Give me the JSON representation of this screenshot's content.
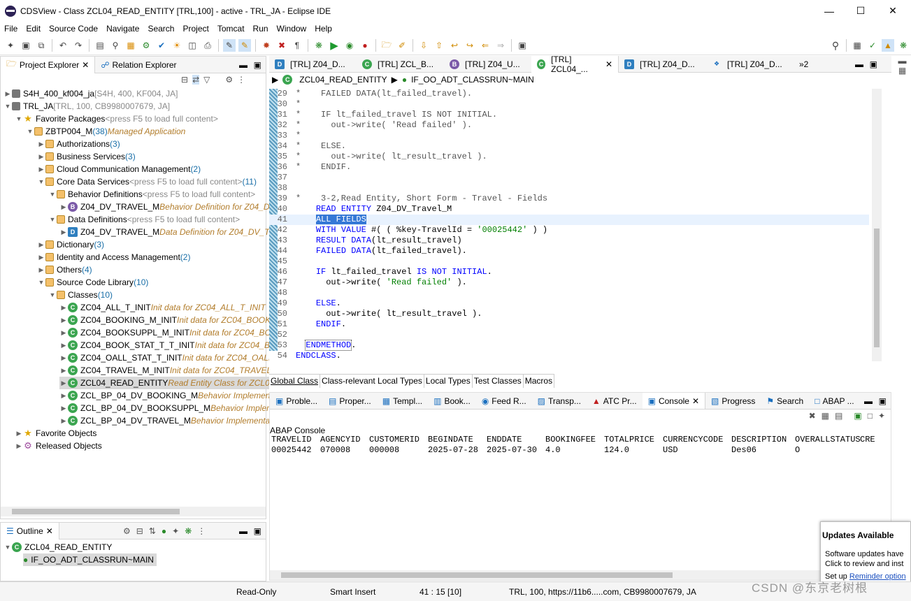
{
  "window": {
    "title": "CDSView - Class ZCL04_READ_ENTITY [TRL,100] - active - TRL_JA - Eclipse IDE"
  },
  "menu": [
    "File",
    "Edit",
    "Source Code",
    "Navigate",
    "Search",
    "Project",
    "Tomcat",
    "Run",
    "Window",
    "Help"
  ],
  "left_tabs": {
    "project_explorer": "Project Explorer",
    "relation_explorer": "Relation Explorer"
  },
  "tree": [
    {
      "level": 0,
      "twisty": "▶",
      "icon": "sys",
      "label": "S4H_400_kf004_ja",
      "extra": "[S4H, 400, KF004, JA]"
    },
    {
      "level": 0,
      "twisty": "▼",
      "icon": "sys",
      "label": "TRL_JA",
      "extra": "[TRL, 100, CB9980007679, JA]"
    },
    {
      "level": 1,
      "twisty": "▼",
      "icon": "star",
      "label": "Favorite Packages",
      "extra": "<press F5 to load full content>"
    },
    {
      "level": 2,
      "twisty": "▼",
      "icon": "pkg",
      "label": "ZBTP004_M",
      "count": "(38)",
      "desc": "Managed Application"
    },
    {
      "level": 3,
      "twisty": "▶",
      "icon": "pkg",
      "label": "Authorizations",
      "count": "(3)"
    },
    {
      "level": 3,
      "twisty": "▶",
      "icon": "pkg",
      "label": "Business Services",
      "count": "(3)"
    },
    {
      "level": 3,
      "twisty": "▶",
      "icon": "pkg",
      "label": "Cloud Communication Management",
      "count": "(2)"
    },
    {
      "level": 3,
      "twisty": "▼",
      "icon": "pkg",
      "label": "Core Data Services",
      "extra": "<press F5 to load full content>",
      "count": "(11)"
    },
    {
      "level": 4,
      "twisty": "▼",
      "icon": "pkg",
      "label": "Behavior Definitions",
      "extra": "<press F5 to load full content>"
    },
    {
      "level": 5,
      "twisty": "▶",
      "icon": "bdef",
      "label": "Z04_DV_TRAVEL_M",
      "desc": "Behavior Definition for Z04_D"
    },
    {
      "level": 4,
      "twisty": "▼",
      "icon": "pkg",
      "label": "Data Definitions",
      "extra": "<press F5 to load full content>"
    },
    {
      "level": 5,
      "twisty": "▶",
      "icon": "ddef",
      "label": "Z04_DV_TRAVEL_M",
      "desc": "Data Definition for Z04_DV_T"
    },
    {
      "level": 3,
      "twisty": "▶",
      "icon": "pkg",
      "label": "Dictionary",
      "count": "(3)"
    },
    {
      "level": 3,
      "twisty": "▶",
      "icon": "pkg",
      "label": "Identity and Access Management",
      "count": "(2)"
    },
    {
      "level": 3,
      "twisty": "▶",
      "icon": "pkg",
      "label": "Others",
      "count": "(4)"
    },
    {
      "level": 3,
      "twisty": "▼",
      "icon": "pkg",
      "label": "Source Code Library",
      "count": "(10)"
    },
    {
      "level": 4,
      "twisty": "▼",
      "icon": "pkg",
      "label": "Classes",
      "count": "(10)"
    },
    {
      "level": 5,
      "twisty": "▶",
      "icon": "cls",
      "label": "ZC04_ALL_T_INIT",
      "desc": "Init data for ZC04_ALL_T_INIT"
    },
    {
      "level": 5,
      "twisty": "▶",
      "icon": "cls",
      "label": "ZC04_BOOKING_M_INIT",
      "desc": "Init data for ZC04_BOOKI"
    },
    {
      "level": 5,
      "twisty": "▶",
      "icon": "cls",
      "label": "ZC04_BOOKSUPPL_M_INIT",
      "desc": "Init data for ZC04_BO"
    },
    {
      "level": 5,
      "twisty": "▶",
      "icon": "cls",
      "label": "ZC04_BOOK_STAT_T_T_INIT",
      "desc": "Init data for ZC04_BO"
    },
    {
      "level": 5,
      "twisty": "▶",
      "icon": "cls",
      "label": "ZC04_OALL_STAT_T_INIT",
      "desc": "Init data for ZC04_OALL"
    },
    {
      "level": 5,
      "twisty": "▶",
      "icon": "cls",
      "label": "ZC04_TRAVEL_M_INIT",
      "desc": "Init data for ZC04_TRAVEL"
    },
    {
      "level": 5,
      "twisty": "▶",
      "icon": "cls",
      "label": "ZCL04_READ_ENTITY",
      "desc": "Read Entity Class for ZCL04",
      "selected": true
    },
    {
      "level": 5,
      "twisty": "▶",
      "icon": "cls",
      "label": "ZCL_BP_04_DV_BOOKING_M",
      "desc": "Behavior Implemen"
    },
    {
      "level": 5,
      "twisty": "▶",
      "icon": "cls",
      "label": "ZCL_BP_04_DV_BOOKSUPPL_M",
      "desc": "Behavior Implem"
    },
    {
      "level": 5,
      "twisty": "▶",
      "icon": "cls",
      "label": "ZCL_BP_04_DV_TRAVEL_M",
      "desc": "Behavior Implementat"
    },
    {
      "level": 1,
      "twisty": "▶",
      "icon": "star",
      "label": "Favorite Objects"
    },
    {
      "level": 1,
      "twisty": "▶",
      "icon": "gear",
      "label": "Released Objects"
    }
  ],
  "outline": {
    "tab": "Outline",
    "class": "ZCL04_READ_ENTITY",
    "method": "IF_OO_ADT_CLASSRUN~MAIN"
  },
  "editor_tabs": [
    "[TRL] Z04_D...",
    "[TRL] ZCL_B...",
    "[TRL] Z04_U...",
    "[TRL] ZCL04_...",
    "[TRL] Z04_D...",
    "[TRL] Z04_D...",
    "»2"
  ],
  "breadcrumb": {
    "class": "ZCL04_READ_ENTITY",
    "method": "IF_OO_ADT_CLASSRUN~MAIN"
  },
  "code": [
    {
      "n": "29",
      "t": "*    FAILED DATA(lt_failed_travel)."
    },
    {
      "n": "30",
      "t": "*"
    },
    {
      "n": "31",
      "t": "*    IF lt_failed_travel IS NOT INITIAL."
    },
    {
      "n": "32",
      "t": "*      out->write( 'Read failed' )."
    },
    {
      "n": "33",
      "t": "*"
    },
    {
      "n": "34",
      "t": "*    ELSE."
    },
    {
      "n": "35",
      "t": "*      out->write( lt_result_travel )."
    },
    {
      "n": "36",
      "t": "*    ENDIF."
    },
    {
      "n": "37",
      "t": ""
    },
    {
      "n": "38",
      "t": ""
    },
    {
      "n": "39",
      "t": "*    3-2,Read Entity, Short Form - Travel - Fields"
    },
    {
      "n": "40",
      "t": "    READ ENTITY Z04_DV_Travel_M"
    },
    {
      "n": "41",
      "t": "    ALL FIELDS"
    },
    {
      "n": "42",
      "t": "    WITH VALUE #( ( %key-TravelId = '00025442' ) )"
    },
    {
      "n": "43",
      "t": "    RESULT DATA(lt_result_travel)"
    },
    {
      "n": "44",
      "t": "    FAILED DATA(lt_failed_travel)."
    },
    {
      "n": "45",
      "t": ""
    },
    {
      "n": "46",
      "t": "    IF lt_failed_travel IS NOT INITIAL."
    },
    {
      "n": "47",
      "t": "      out->write( 'Read failed' )."
    },
    {
      "n": "48",
      "t": ""
    },
    {
      "n": "49",
      "t": "    ELSE."
    },
    {
      "n": "50",
      "t": "      out->write( lt_result_travel )."
    },
    {
      "n": "51",
      "t": "    ENDIF."
    },
    {
      "n": "52",
      "t": ""
    },
    {
      "n": "53",
      "t": "  ENDMETHOD."
    },
    {
      "n": "54",
      "t": "ENDCLASS."
    }
  ],
  "editor_bottom_tabs": [
    "Global Class",
    "Class-relevant Local Types",
    "Local Types",
    "Test Classes",
    "Macros"
  ],
  "bottom_views": [
    "Proble...",
    "Proper...",
    "Templ...",
    "Book...",
    "Feed R...",
    "Transp...",
    "ATC Pr...",
    "Console",
    "Progress",
    "Search",
    "ABAP ..."
  ],
  "console": {
    "title": "ABAP Console",
    "headers": [
      "TRAVELID",
      "AGENCYID",
      "CUSTOMERID",
      "BEGINDATE",
      "ENDDATE",
      "BOOKINGFEE",
      "TOTALPRICE",
      "CURRENCYCODE",
      "DESCRIPTION",
      "OVERALLSTATUS",
      "CRE"
    ],
    "row": [
      "00025442",
      "070008",
      "000008",
      "2025-07-28",
      "2025-07-30",
      "4.0",
      "124.0",
      "USD",
      "Des06",
      "O",
      ""
    ]
  },
  "notification": {
    "title": "Updates Available",
    "line1": "Software updates have",
    "line2": "Click to review and inst",
    "line3a": "Set up",
    "line3b": "Reminder option"
  },
  "status": {
    "mode": "Read-Only",
    "insert": "Smart Insert",
    "pos": "41 : 15 [10]",
    "conn": "TRL, 100, https://11b6.....com, CB9980007679, JA"
  },
  "watermark": "CSDN @东京老树根"
}
